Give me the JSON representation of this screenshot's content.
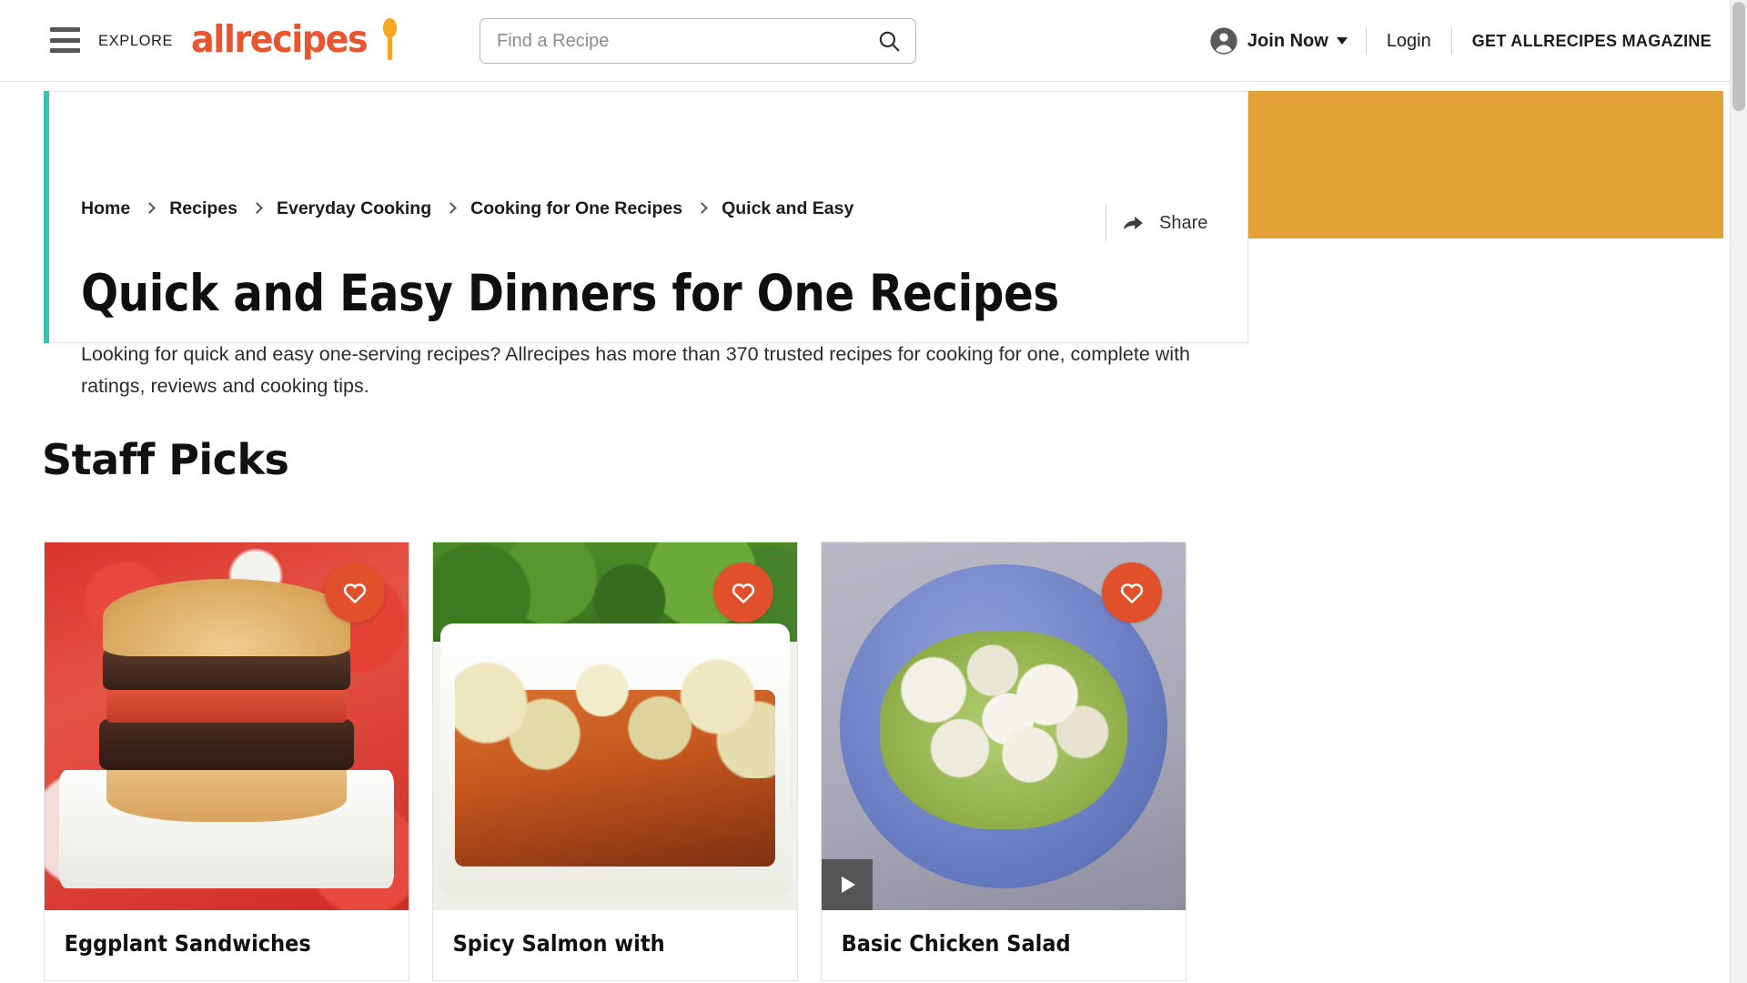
{
  "header": {
    "explore_label": "EXPLORE",
    "logo_text": "allrecipes",
    "search": {
      "placeholder": "Find a Recipe",
      "value": "",
      "icon": "search-icon"
    },
    "join_now_label": "Join Now",
    "login_label": "Login",
    "magazine_label": "GET ALLRECIPES MAGAZINE",
    "menu_icon": "hamburger-menu-icon",
    "account_icon": "account-circle-icon",
    "caret_icon": "chevron-down-icon"
  },
  "hero": {
    "breadcrumb": [
      "Home",
      "Recipes",
      "Everyday Cooking",
      "Cooking for One Recipes",
      "Quick and Easy"
    ],
    "share_label": "Share",
    "share_icon": "share-arrow-icon",
    "title": "Quick and Easy Dinners for One Recipes",
    "description": "Looking for quick and easy one-serving recipes? Allrecipes has more than 370 trusted recipes for cooking for one, complete with ratings, reviews and cooking tips.",
    "accent_color": "#35C4AF",
    "banner_color": "#E3A238"
  },
  "staff_picks": {
    "heading": "Staff Picks",
    "cards": [
      {
        "title": "Eggplant Sandwiches",
        "favorite_icon": "heart-outline-icon",
        "has_video": false
      },
      {
        "title": "Spicy Salmon with",
        "favorite_icon": "heart-outline-icon",
        "has_video": false
      },
      {
        "title": "Basic Chicken Salad",
        "favorite_icon": "heart-outline-icon",
        "has_video": true,
        "play_icon": "play-triangle-icon"
      }
    ]
  },
  "colors": {
    "brand_orange": "#E8552F",
    "favorite_button": "#E0512B",
    "teal_accent": "#35C4AF",
    "gold_banner": "#E3A238"
  }
}
